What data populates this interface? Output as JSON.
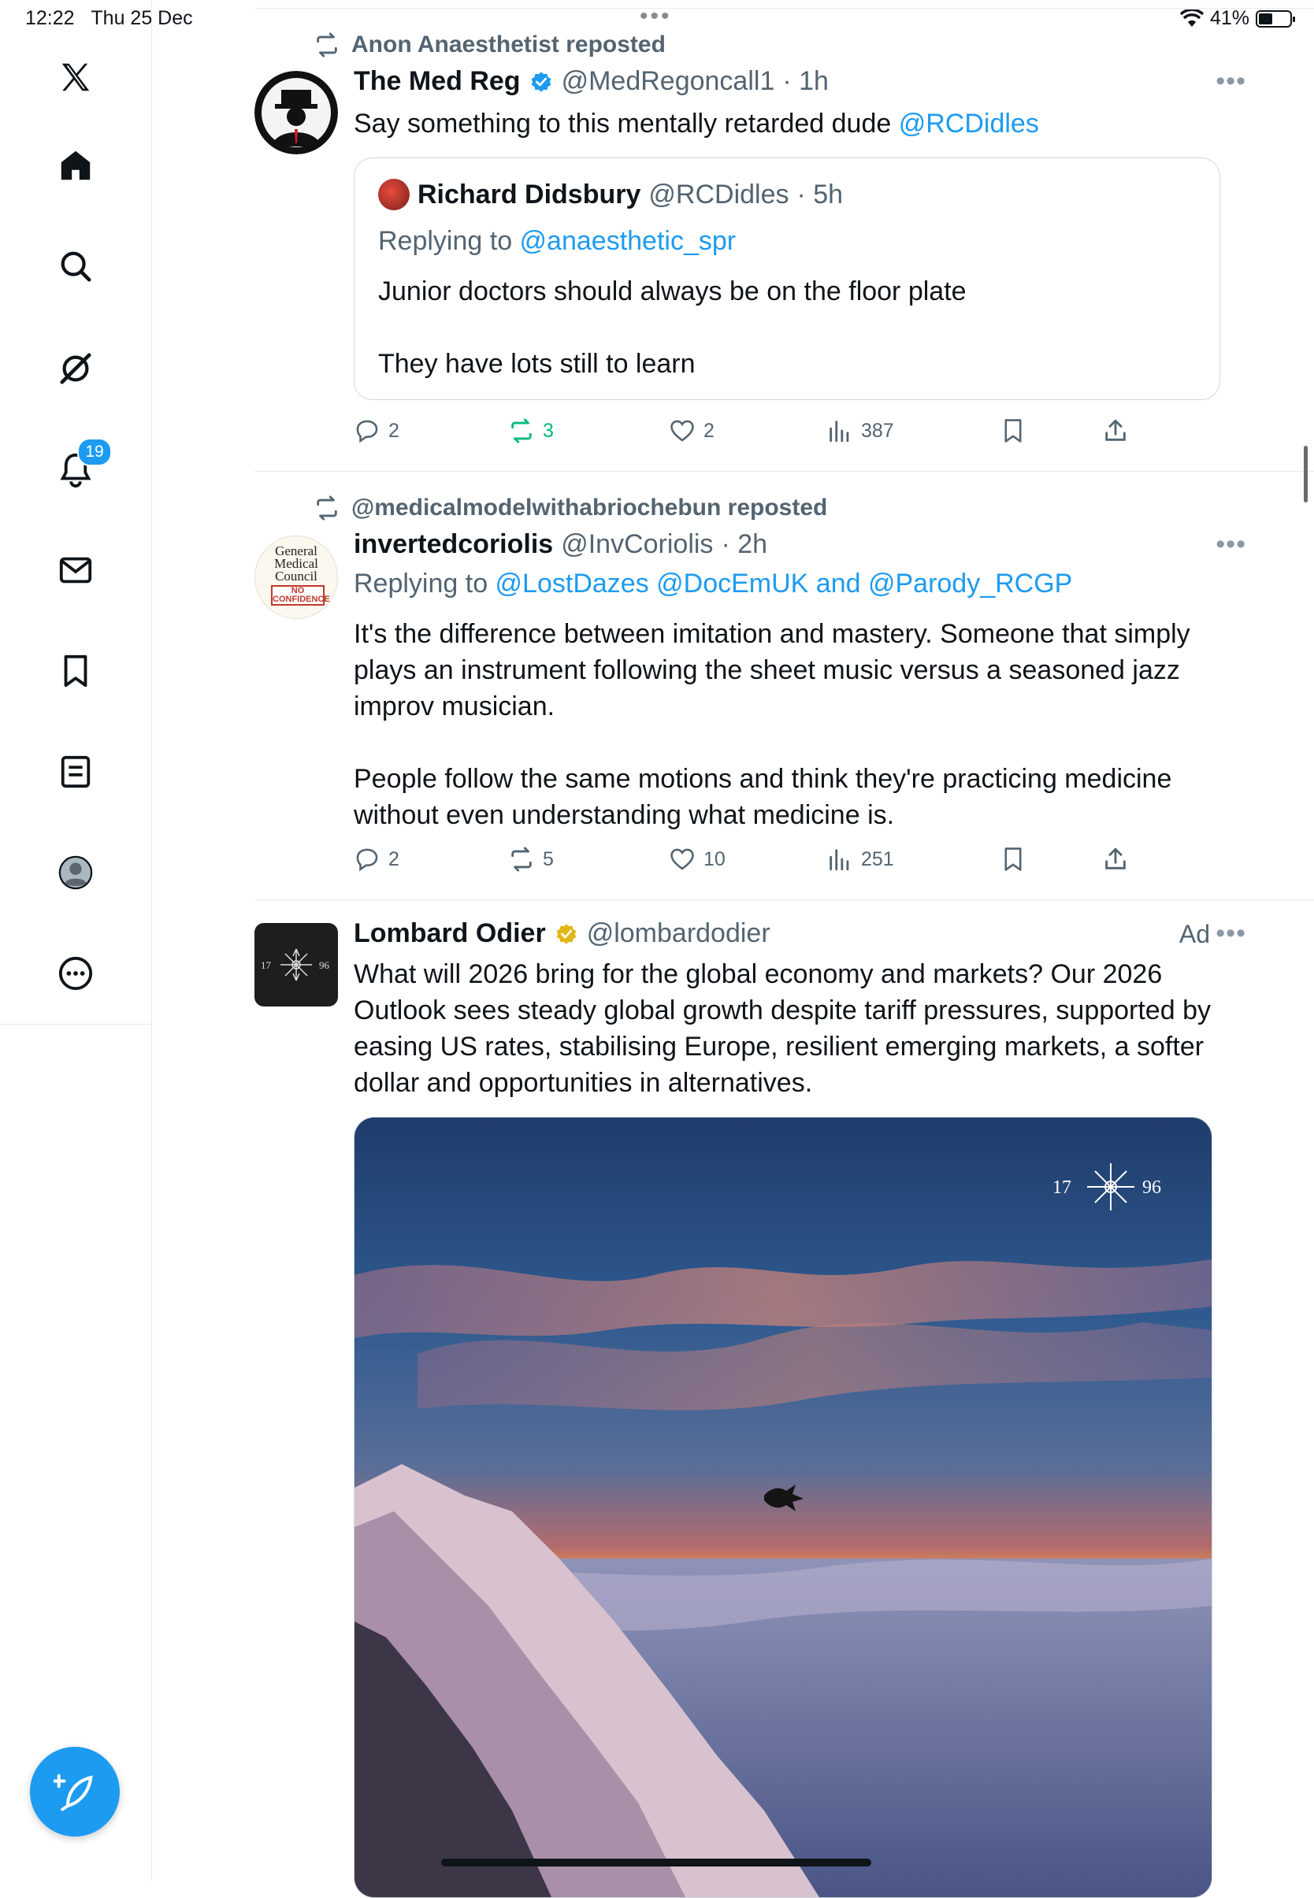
{
  "status_bar": {
    "time": "12:22",
    "date": "Thu 25 Dec",
    "battery": "41%",
    "battery_level": 0.41
  },
  "sidebar": {
    "notifications_badge": "19",
    "items": [
      "x-logo",
      "home",
      "search",
      "grok",
      "notifications",
      "messages",
      "bookmarks",
      "lists",
      "profile",
      "more"
    ]
  },
  "posts": [
    {
      "repost_by": "Anon Anaesthetist reposted",
      "name": "The Med Reg",
      "handle": "@MedRegoncall1",
      "time": "· 1h",
      "text": "Say something to this mentally retarded dude ",
      "mention": "@RCDidles",
      "quote": {
        "name": "Richard Didsbury",
        "handle": "@RCDidles",
        "time": "· 5h",
        "replying_label": "Replying to ",
        "replying_to": "@anaesthetic_spr",
        "line1": "Junior doctors should always be on the floor plate",
        "line2": "They have lots still to learn"
      },
      "replies": "2",
      "reposts": "3",
      "likes": "2",
      "views": "387"
    },
    {
      "repost_by": "@medicalmodelwithabriochebun reposted",
      "name": "invertedcoriolis",
      "handle": "@InvCoriolis",
      "time": "· 2h",
      "replying_label": "Replying to ",
      "replying_to": "@LostDazes @DocEmUK and @Parody_RCGP",
      "para1": "It's the difference between imitation and mastery. Someone that simply plays an instrument following the sheet music versus a seasoned jazz improv musician.",
      "para2": "People follow the same motions and think they're practicing medicine without even understanding what medicine is.",
      "avatar_lines": [
        "General",
        "Medical",
        "Council",
        "NO",
        "CONFIDENCE"
      ],
      "replies": "2",
      "reposts": "5",
      "likes": "10",
      "views": "251"
    },
    {
      "name": "Lombard Odier",
      "handle": "@lombardodier",
      "ad_label": "Ad",
      "text": "What will 2026 bring for the global economy and markets? Our 2026 Outlook sees steady global growth despite tariff pressures, supported by easing US rates, stabilising Europe, resilient emerging markets, a softer dollar and opportunities in alternatives.",
      "logo_left": "17",
      "logo_right": "96"
    }
  ]
}
